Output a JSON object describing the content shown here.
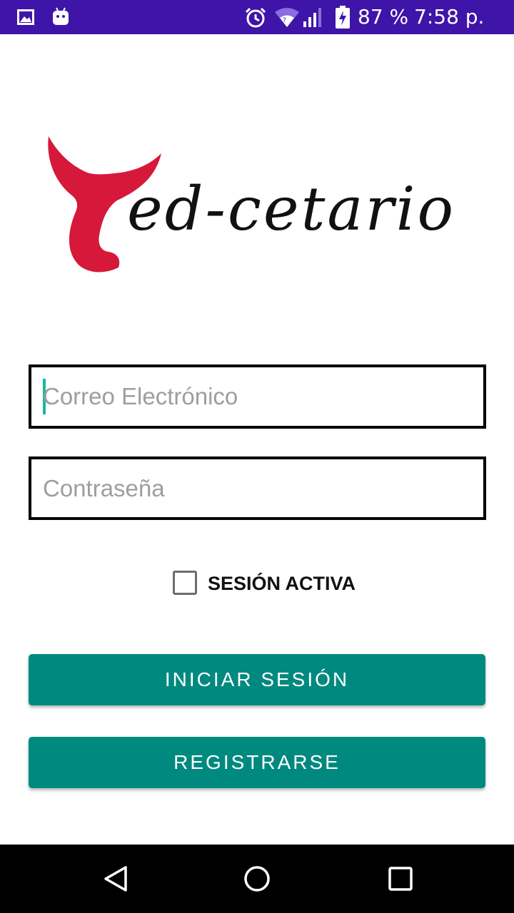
{
  "status_bar": {
    "battery_percent": "87 %",
    "time": "7:58 p. m.",
    "background_color": "#3f14a8",
    "icons": [
      "gallery-icon",
      "android-icon",
      "alarm-icon",
      "wifi-icon",
      "signal-icon",
      "battery-charging-icon"
    ]
  },
  "logo": {
    "brand_text": "ed-cetario",
    "tail_color": "#d6193a"
  },
  "login_form": {
    "email_placeholder": "Correo Electrónico",
    "email_value": "",
    "password_placeholder": "Contraseña",
    "password_value": "",
    "keep_session_label": "SESIÓN ACTIVA",
    "keep_session_checked": false,
    "login_button_label": "INICIAR SESIÓN",
    "register_button_label": "REGISTRARSE",
    "accent_color": "#00897f"
  },
  "navigation_bar": {
    "icons": [
      "back-icon",
      "home-icon",
      "recents-icon"
    ]
  }
}
